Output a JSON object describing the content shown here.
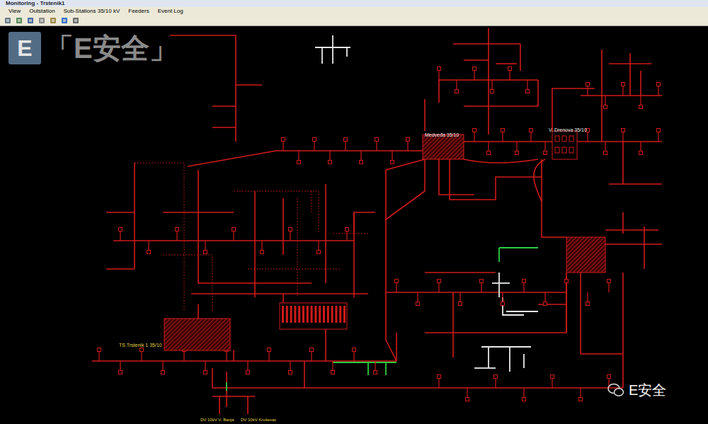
{
  "window": {
    "title": "Monitoring - Trstenik1"
  },
  "menu": [
    "View",
    "Outstation",
    "Sub-Stations 35/10 kV",
    "Feeders",
    "Event Log"
  ],
  "watermark": {
    "mark": "E",
    "text": "「E安全」"
  },
  "wechat_watermark": {
    "text": "E安全"
  },
  "stations": [
    {
      "name": "Medveđa 35/10",
      "color": "#e8e8e8"
    },
    {
      "name": "V. Drenova 35/10",
      "color": "#e8e8e8"
    },
    {
      "name": "TS Trstenik 1 35/10",
      "color": "#e0d040"
    }
  ],
  "feeders": [
    {
      "name": "DV 10kV V. Banja",
      "color": "#e0d040"
    },
    {
      "name": "DV 10kV Kruševac",
      "color": "#e0d040"
    }
  ],
  "line_groups": [
    {
      "kind": "energized",
      "color": "#d01a1a"
    },
    {
      "kind": "deenergized",
      "color": "#e8e8e8"
    },
    {
      "kind": "earthed",
      "color": "#2ecc40"
    }
  ]
}
